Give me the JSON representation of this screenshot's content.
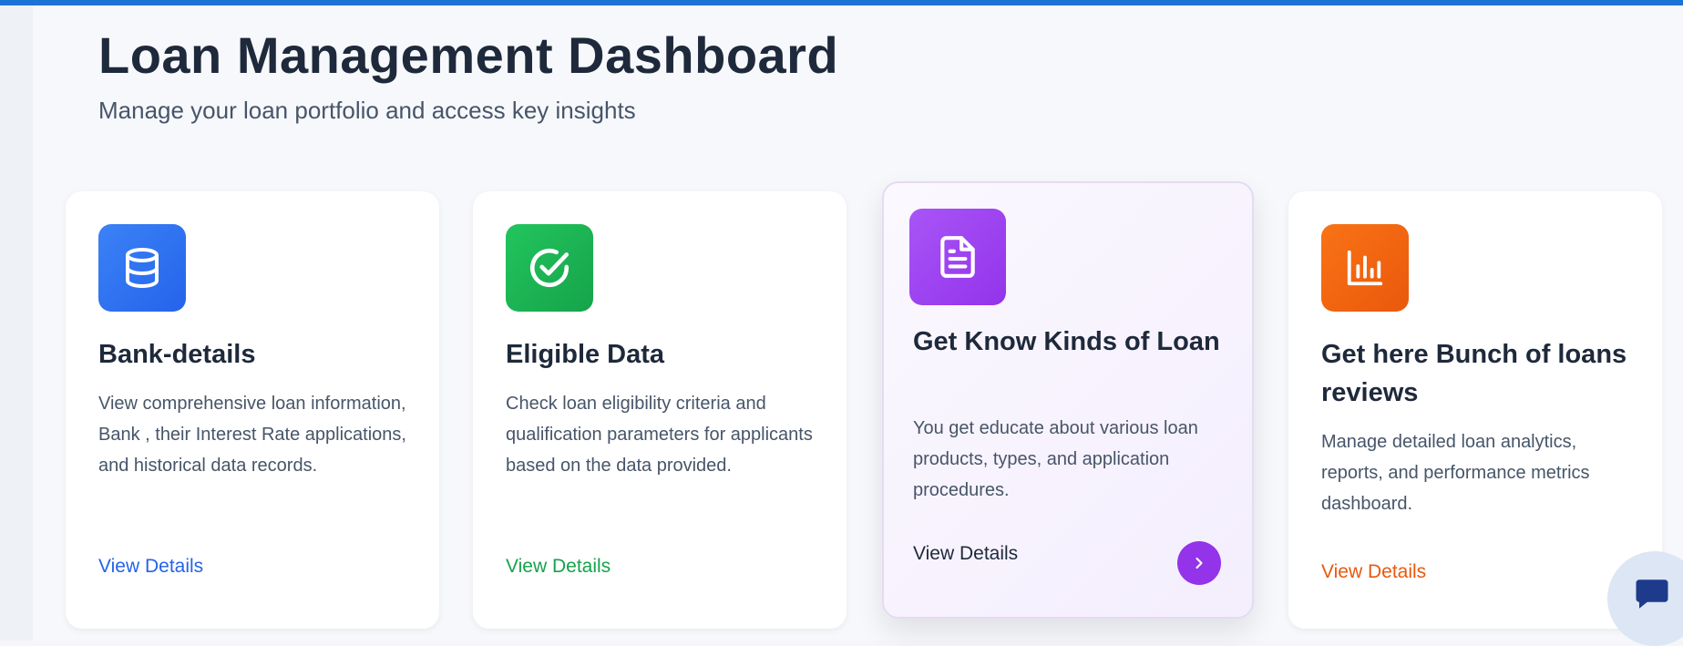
{
  "header": {
    "title": "Loan Management Dashboard",
    "subtitle": "Manage your loan portfolio and access key insights"
  },
  "cards": [
    {
      "icon": "database-icon",
      "color": "#2563eb",
      "title": "Bank-details",
      "description": "View comprehensive loan information, Bank , their Interest Rate applications, and historical data records.",
      "link": "View Details"
    },
    {
      "icon": "check-circle-icon",
      "color": "#16a34a",
      "title": "Eligible Data",
      "description": "Check loan eligibility criteria and qualification parameters for applicants based on the data provided.",
      "link": "View Details"
    },
    {
      "icon": "document-icon",
      "color": "#9333ea",
      "title": "Get Know Kinds of Loan",
      "description": "You get educate about various loan products, types, and application procedures.",
      "link": "View Details",
      "arrow_icon": "chevron-right-icon"
    },
    {
      "icon": "bar-chart-icon",
      "color": "#ea580c",
      "title": "Get here Bunch of loans reviews",
      "description": "Manage detailed loan analytics, reports, and performance metrics dashboard.",
      "link": "View Details"
    }
  ],
  "chat": {
    "icon": "chat-bubble-icon"
  },
  "colors": {
    "accent_bar": "#1d72d6",
    "background": "#f7f8fb"
  }
}
